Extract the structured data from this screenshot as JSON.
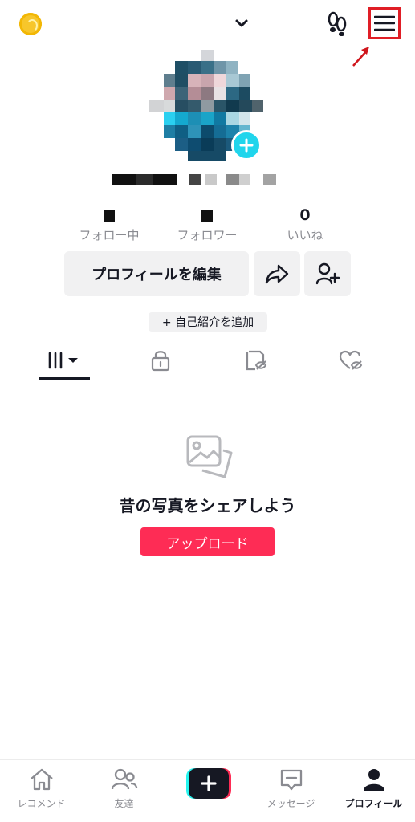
{
  "header": {
    "coin_icon": "coin-icon",
    "switch_icon": "chevron-down-icon",
    "footprint_icon": "footprints-icon",
    "menu_icon": "hamburger-menu-icon"
  },
  "profile": {
    "avatar_add_icon": "plus-icon"
  },
  "stats": [
    {
      "value": "",
      "label": "フォロー中"
    },
    {
      "value": "",
      "label": "フォロワー"
    },
    {
      "value": "0",
      "label": "いいね"
    }
  ],
  "actions": {
    "edit_label": "プロフィールを編集",
    "share_icon": "share-arrow-icon",
    "add_friend_icon": "add-user-icon"
  },
  "bio": {
    "add_label": "+ 自己紹介を追加"
  },
  "tabs": [
    {
      "icon": "grid-icon",
      "active": true
    },
    {
      "icon": "lock-icon",
      "active": false
    },
    {
      "icon": "hidden-repost-icon",
      "active": false
    },
    {
      "icon": "hidden-liked-icon",
      "active": false
    }
  ],
  "empty_state": {
    "title": "昔の写真をシェアしよう",
    "button": "アップロード",
    "icon": "photos-icon"
  },
  "bottom_nav": [
    {
      "label": "レコメンド",
      "icon": "home-icon"
    },
    {
      "label": "友達",
      "icon": "friends-icon"
    },
    {
      "label": "",
      "icon": "create-plus-icon"
    },
    {
      "label": "メッセージ",
      "icon": "message-icon"
    },
    {
      "label": "プロフィール",
      "icon": "profile-icon",
      "active": true
    }
  ],
  "colors": {
    "accent": "#fe2c55",
    "add": "#20d5ec",
    "highlight": "#e01e26"
  }
}
